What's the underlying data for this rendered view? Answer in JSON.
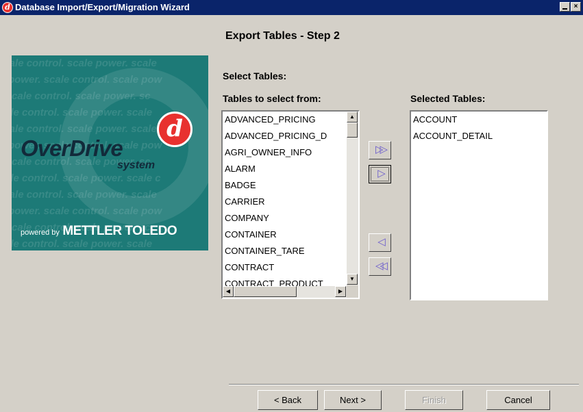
{
  "window": {
    "title": "Database Import/Export/Migration Wizard",
    "icon": "overdrive-d-icon",
    "controls": {
      "minimize": "minimize-icon",
      "close": "×"
    }
  },
  "step_title": "Export Tables - Step 2",
  "logo": {
    "pattern_text": "scale control. scale power. scale control. scale power.",
    "brand": "OverDrive",
    "system": "system",
    "badge_letter": "d",
    "powered_by": "powered by",
    "company": "METTLER TOLEDO"
  },
  "labels": {
    "select_tables": "Select Tables:",
    "tables_from": "Tables to select from:",
    "selected_tables": "Selected Tables:"
  },
  "source_tables": [
    "ADVANCED_PRICING",
    "ADVANCED_PRICING_D",
    "AGRI_OWNER_INFO",
    "ALARM",
    "BADGE",
    "CARRIER",
    "COMPANY",
    "CONTAINER",
    "CONTAINER_TARE",
    "CONTRACT",
    "CONTRACT_PRODUCT"
  ],
  "selected_tables": [
    "ACCOUNT",
    "ACCOUNT_DETAIL"
  ],
  "transfer_buttons": {
    "add_all": "▷▷",
    "add": "▷",
    "remove": "◁",
    "remove_all": "◁◁"
  },
  "buttons": {
    "back": "< Back",
    "next": "Next >",
    "finish": "Finish",
    "cancel": "Cancel"
  },
  "colors": {
    "title_bar": "#0a246a",
    "dialog_bg": "#d4d0c8",
    "logo_bg": "#1d7a77",
    "accent_red": "#e8312f",
    "arrow_color": "#6a5acd"
  }
}
